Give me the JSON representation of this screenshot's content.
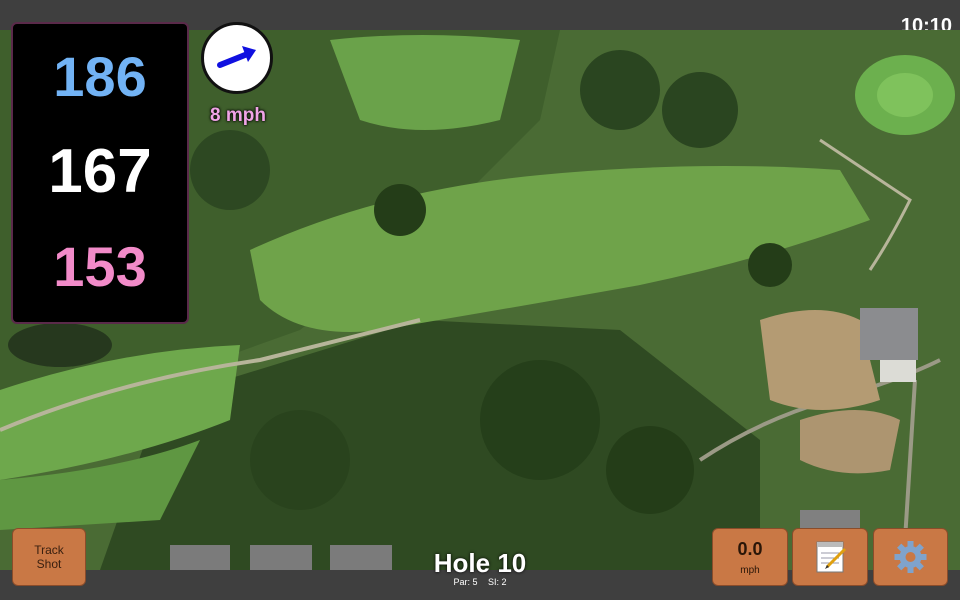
{
  "status_bar": {
    "time": "10:10"
  },
  "yardages": {
    "back": "186",
    "middle": "167",
    "front": "153"
  },
  "wind": {
    "speed_label": "8 mph",
    "direction_icon": "arrow-icon"
  },
  "buttons": {
    "track_shot_line1": "Track",
    "track_shot_line2": "Shot",
    "speed_value": "0.0",
    "speed_unit": "mph",
    "notes_icon": "notepad-icon",
    "settings_icon": "gear-icon"
  },
  "hole": {
    "title": "Hole 10",
    "par": "Par: 5",
    "si": "SI: 2"
  },
  "colors": {
    "back": "#72b3f5",
    "middle": "#ffffff",
    "front": "#f28bc9",
    "button": "#c97845"
  }
}
